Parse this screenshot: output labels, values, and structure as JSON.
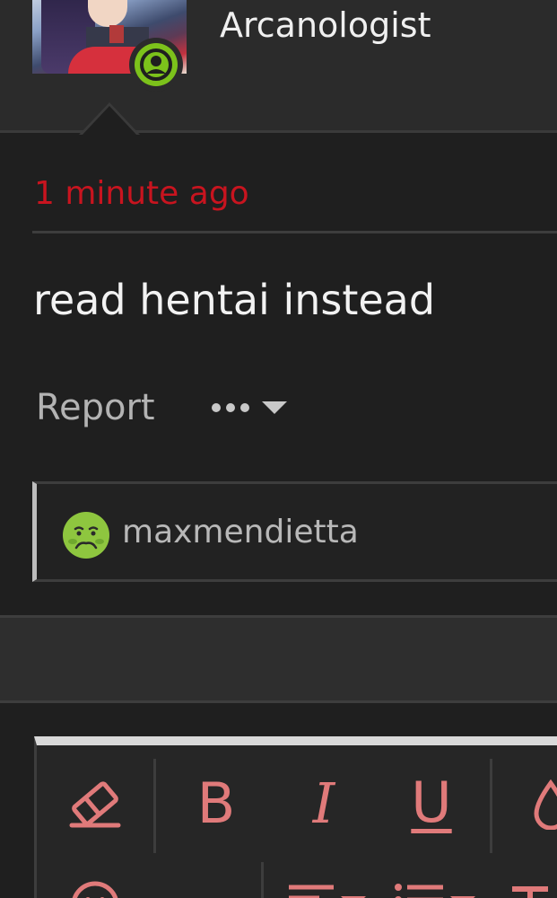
{
  "user": {
    "name": "Arcanologist",
    "status": "online"
  },
  "message": {
    "timestamp": "1 minute ago",
    "body": "read hentai instead",
    "report_label": "Report"
  },
  "reaction": {
    "emoji": "nauseated-face",
    "username": "maxmendietta"
  },
  "toolbar": {
    "bold_label": "B",
    "italic_label": "I",
    "underline_label": "U"
  },
  "colors": {
    "timestamp": "#c8141f",
    "status_online": "#7cc21b",
    "toolbar_icon": "#e07a7a",
    "background": "#1f1f1f"
  }
}
